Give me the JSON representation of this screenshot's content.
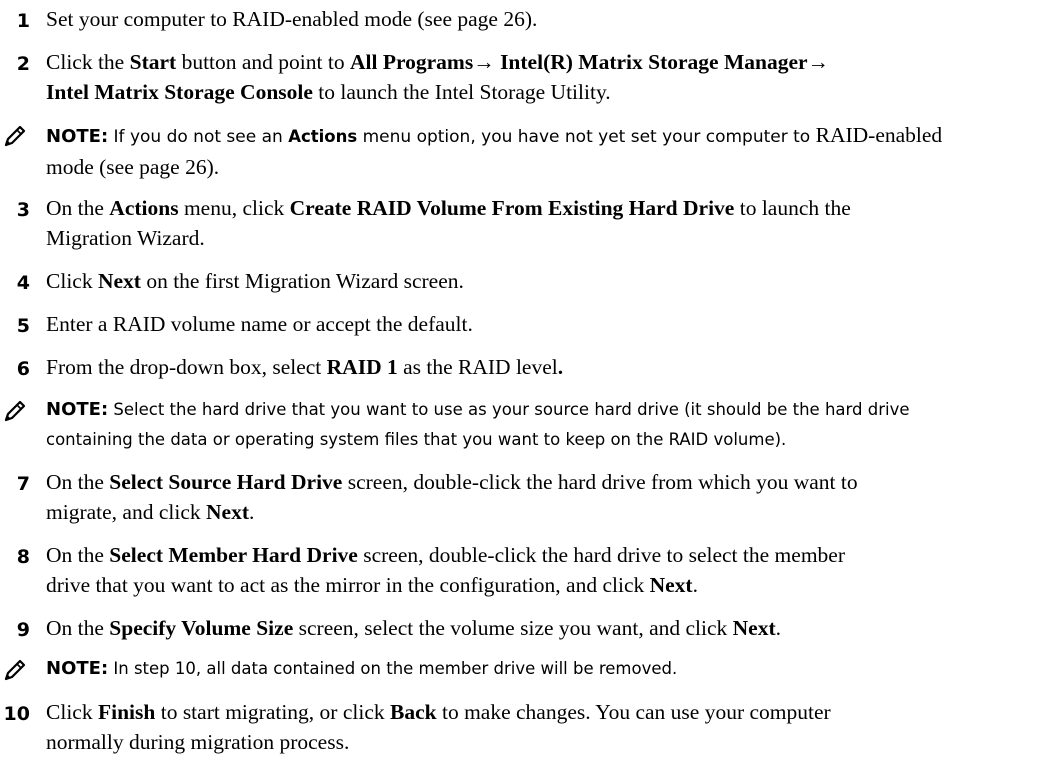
{
  "steps": [
    {
      "num": "1",
      "t": [
        "Set your computer to RAID-enabled mode (see page 26)."
      ]
    },
    {
      "num": "2",
      "t": [
        "Click the ",
        "Start",
        " button and point to ",
        "All Programs→ Intel(R) Matrix Storage Manager→",
        "Intel Matrix Storage Console",
        " to launch the Intel Storage Utility."
      ]
    },
    {
      "num": "3",
      "t": [
        "On the ",
        "Actions",
        " menu, click ",
        "Create RAID Volume From Existing Hard Drive",
        " to launch the",
        "Migration Wizard."
      ]
    },
    {
      "num": "4",
      "t": [
        "Click ",
        "Next",
        " on the first Migration Wizard screen."
      ]
    },
    {
      "num": "5",
      "t": [
        "Enter a RAID volume name or accept the default."
      ]
    },
    {
      "num": "6",
      "t": [
        "From the drop-down box, select ",
        "RAID 1",
        " as the RAID level",
        "."
      ]
    },
    {
      "num": "7",
      "t": [
        "On the ",
        "Select Source Hard Drive",
        " screen, double-click the hard drive from which you want to",
        "migrate, and click ",
        "Next",
        "."
      ]
    },
    {
      "num": "8",
      "t": [
        "On the ",
        "Select Member Hard Drive",
        " screen, double-click the hard drive to select the member",
        "drive that you want to act as the mirror in the configuration, and click ",
        "Next",
        "."
      ]
    },
    {
      "num": "9",
      "t": [
        "On the ",
        "Specify Volume Size",
        " screen, select the volume size you want, and click ",
        "Next",
        "."
      ]
    },
    {
      "num": "10",
      "t": [
        "Click ",
        "Finish",
        " to start migrating, or click ",
        "Back",
        " to make changes. You can use your computer",
        "normally during migration process."
      ]
    }
  ],
  "notes": [
    {
      "label": "NOTE:",
      "t": [
        " If you do not see an ",
        "Actions",
        " menu option, you have not yet set your computer to ",
        "RAID-enabled",
        "mode (see page 26)."
      ]
    },
    {
      "label": "NOTE:",
      "t": [
        " Select the hard drive that you want to use as your source hard drive (it should be the hard drive",
        "containing the data or operating system files that you want to keep on the RAID volume)."
      ]
    },
    {
      "label": "NOTE:",
      "t": [
        " In step 10, all data contained on the member drive will be removed."
      ]
    }
  ]
}
